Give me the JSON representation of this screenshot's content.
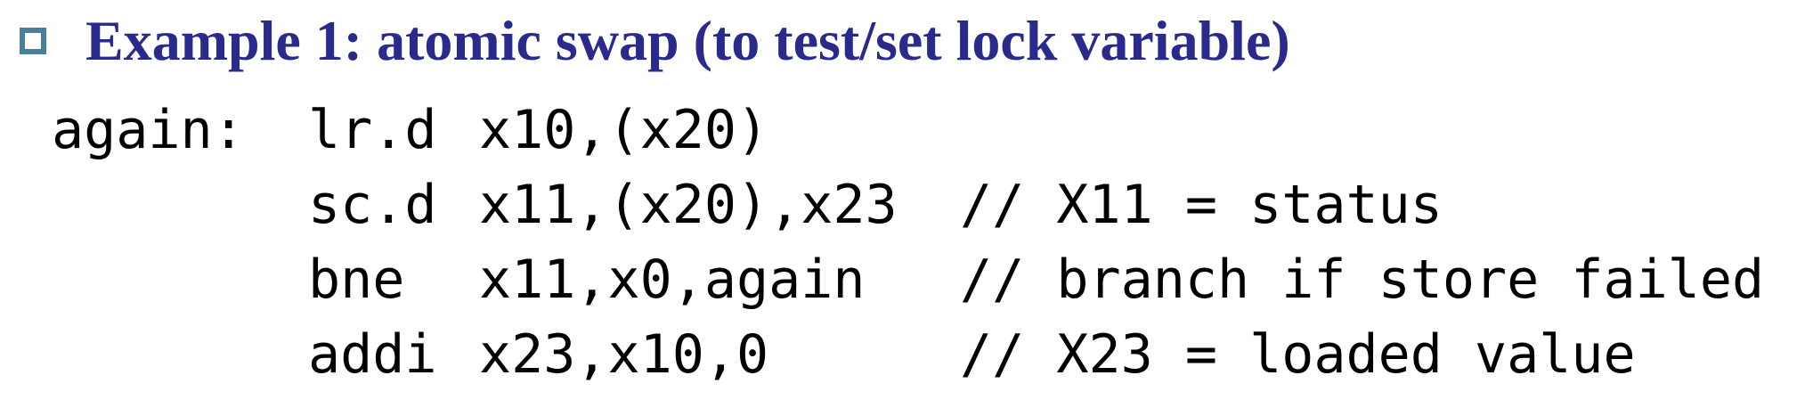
{
  "heading": {
    "text": "Example 1: atomic swap (to test/set lock variable)",
    "bullet_icon": "hollow-square-bullet-icon",
    "bullet_color": "#4a7f9a",
    "text_color": "#2a2a8c"
  },
  "code": {
    "lines": [
      {
        "label": "again:",
        "op": "lr.d",
        "args": "x10,(x20)",
        "comment": ""
      },
      {
        "label": "",
        "op": "sc.d",
        "args": "x11,(x20),x23",
        "comment": "// X11 = status"
      },
      {
        "label": "",
        "op": "bne",
        "args": "x11,x0,again",
        "comment": "// branch if store failed"
      },
      {
        "label": "",
        "op": "addi",
        "args": "x23,x10,0",
        "comment": "// X23 = loaded value"
      }
    ]
  }
}
